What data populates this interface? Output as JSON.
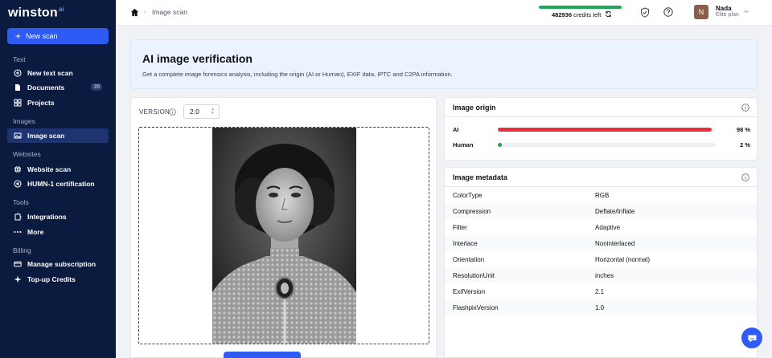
{
  "app": {
    "logo": "winston",
    "logo_suffix": "ai"
  },
  "sidebar": {
    "new_scan": "New scan",
    "sections": {
      "text": "Text",
      "images": "Images",
      "websites": "Websites",
      "tools": "Tools",
      "billing": "Billing"
    },
    "items": {
      "new_text_scan": "New text scan",
      "documents": "Documents",
      "documents_count": "39",
      "projects": "Projects",
      "image_scan": "Image scan",
      "website_scan": "Website scan",
      "humn_certification": "HUMN-1 certification",
      "integrations": "Integrations",
      "more": "More",
      "manage_subscription": "Manage subscription",
      "topup_credits": "Top-up Credits"
    }
  },
  "header": {
    "breadcrumb": "Image scan",
    "credits_amount": "482936",
    "credits_suffix": "credits left",
    "credits_progress": 0.97,
    "user_initial": "N",
    "user_name": "Nada",
    "user_plan": "Elite plan"
  },
  "hero": {
    "title": "AI image verification",
    "subtitle": "Get a complete image forensics analysis, including the origin (AI or Human), EXIF data, IPTC and C2PA information."
  },
  "scan": {
    "version_label": "VERSION",
    "version_value": "2.0"
  },
  "origin": {
    "title": "Image origin",
    "rows": [
      {
        "label": "AI",
        "value": 98,
        "display": "98 %",
        "color": "#e5323e"
      },
      {
        "label": "Human",
        "value": 2,
        "display": "2 %",
        "color": "#1fa85a"
      }
    ]
  },
  "metadata": {
    "title": "Image metadata",
    "rows": [
      {
        "key": "ColorType",
        "value": "RGB"
      },
      {
        "key": "Compression",
        "value": "Deflate/Inflate"
      },
      {
        "key": "Filter",
        "value": "Adaptive"
      },
      {
        "key": "Interlace",
        "value": "Noninterlaced"
      },
      {
        "key": "Orientation",
        "value": "Horizontal (normal)"
      },
      {
        "key": "ResolutionUnit",
        "value": "inches"
      },
      {
        "key": "ExifVersion",
        "value": "2.1"
      },
      {
        "key": "FlashpixVersion",
        "value": "1.0"
      }
    ]
  },
  "colors": {
    "sidebar_bg": "#0b1b3f",
    "accent": "#2f5bf5",
    "ai_red": "#e5323e",
    "human_green": "#1fa85a"
  }
}
